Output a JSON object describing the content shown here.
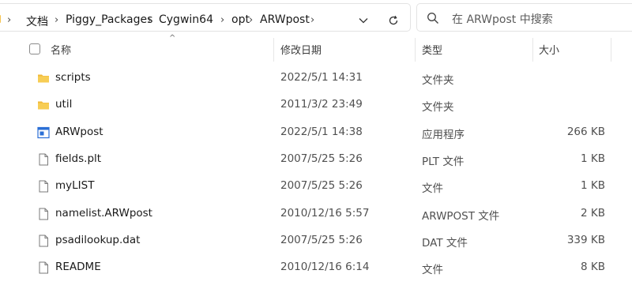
{
  "breadcrumb": [
    "文档",
    "Piggy_Packages",
    "Cygwin64",
    "opt",
    "ARWpost"
  ],
  "breadcrumb_separator": "›",
  "search": {
    "placeholder": "在 ARWpost 中搜索"
  },
  "columns": {
    "name": "名称",
    "modified": "修改日期",
    "type": "类型",
    "size": "大小"
  },
  "files": [
    {
      "name": "scripts",
      "modified": "2022/5/1 14:31",
      "type": "文件夹",
      "size": "",
      "icon": "folder-icon"
    },
    {
      "name": "util",
      "modified": "2011/3/2 23:49",
      "type": "文件夹",
      "size": "",
      "icon": "folder-icon"
    },
    {
      "name": "ARWpost",
      "modified": "2022/5/1 14:38",
      "type": "应用程序",
      "size": "266 KB",
      "icon": "application-icon"
    },
    {
      "name": "fields.plt",
      "modified": "2007/5/25 5:26",
      "type": "PLT 文件",
      "size": "1 KB",
      "icon": "file-icon"
    },
    {
      "name": "myLIST",
      "modified": "2007/5/25 5:26",
      "type": "文件",
      "size": "1 KB",
      "icon": "file-icon"
    },
    {
      "name": "namelist.ARWpost",
      "modified": "2010/12/16 5:57",
      "type": "ARWPOST 文件",
      "size": "2 KB",
      "icon": "file-icon"
    },
    {
      "name": "psadilookup.dat",
      "modified": "2007/5/25 5:26",
      "type": "DAT 文件",
      "size": "339 KB",
      "icon": "file-icon"
    },
    {
      "name": "README",
      "modified": "2010/12/16 6:14",
      "type": "文件",
      "size": "8 KB",
      "icon": "file-icon"
    }
  ],
  "colors": {
    "folder": "#f5c451",
    "app_blue": "#2b6fd6",
    "border": "#e3e3e3"
  }
}
